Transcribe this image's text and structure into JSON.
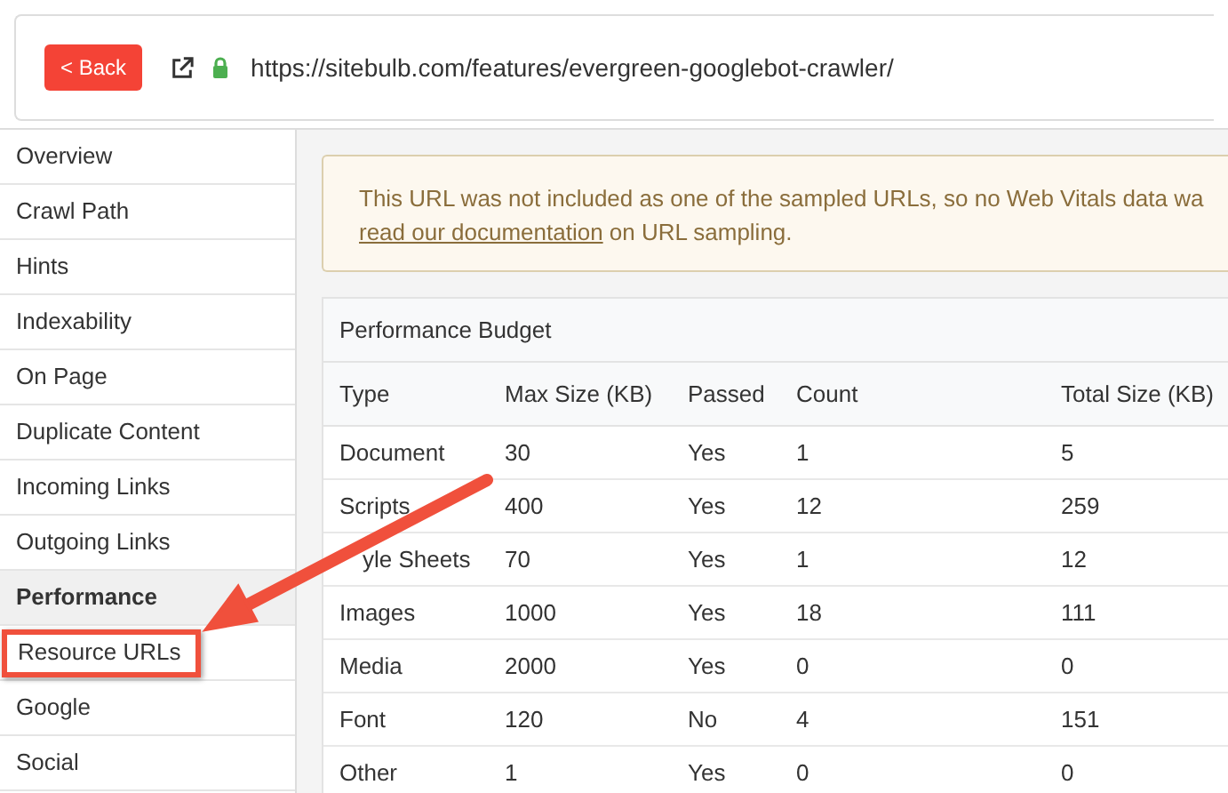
{
  "toolbar": {
    "back_button": "< Back",
    "url": "https://sitebulb.com/features/evergreen-googlebot-crawler/"
  },
  "sidebar": {
    "items": [
      {
        "label": "Overview",
        "selected": false,
        "highlighted": false
      },
      {
        "label": "Crawl Path",
        "selected": false,
        "highlighted": false
      },
      {
        "label": "Hints",
        "selected": false,
        "highlighted": false
      },
      {
        "label": "Indexability",
        "selected": false,
        "highlighted": false
      },
      {
        "label": "On Page",
        "selected": false,
        "highlighted": false
      },
      {
        "label": "Duplicate Content",
        "selected": false,
        "highlighted": false
      },
      {
        "label": "Incoming Links",
        "selected": false,
        "highlighted": false
      },
      {
        "label": "Outgoing Links",
        "selected": false,
        "highlighted": false
      },
      {
        "label": "Performance",
        "selected": true,
        "highlighted": false
      },
      {
        "label": "Resource URLs",
        "selected": false,
        "highlighted": true
      },
      {
        "label": "Google",
        "selected": false,
        "highlighted": false
      },
      {
        "label": "Social",
        "selected": false,
        "highlighted": false
      }
    ]
  },
  "notice": {
    "text": "This URL was not included as one of the sampled URLs, so no Web Vitals data wa",
    "link": "read our documentation",
    "after_link": " on URL sampling."
  },
  "table": {
    "title": "Performance Budget",
    "columns": [
      "Type",
      "Max Size (KB)",
      "Passed",
      "Count",
      "Total Size (KB)"
    ],
    "rows": [
      [
        "Document",
        "30",
        "Yes",
        "1",
        "5"
      ],
      [
        "Scripts",
        "400",
        "Yes",
        "12",
        "259"
      ],
      [
        "yle Sheets",
        "70",
        "Yes",
        "1",
        "12"
      ],
      [
        "Images",
        "1000",
        "Yes",
        "18",
        "111"
      ],
      [
        "Media",
        "2000",
        "Yes",
        "0",
        "0"
      ],
      [
        "Font",
        "120",
        "No",
        "4",
        "151"
      ],
      [
        "Other",
        "1",
        "Yes",
        "0",
        "0"
      ]
    ]
  }
}
